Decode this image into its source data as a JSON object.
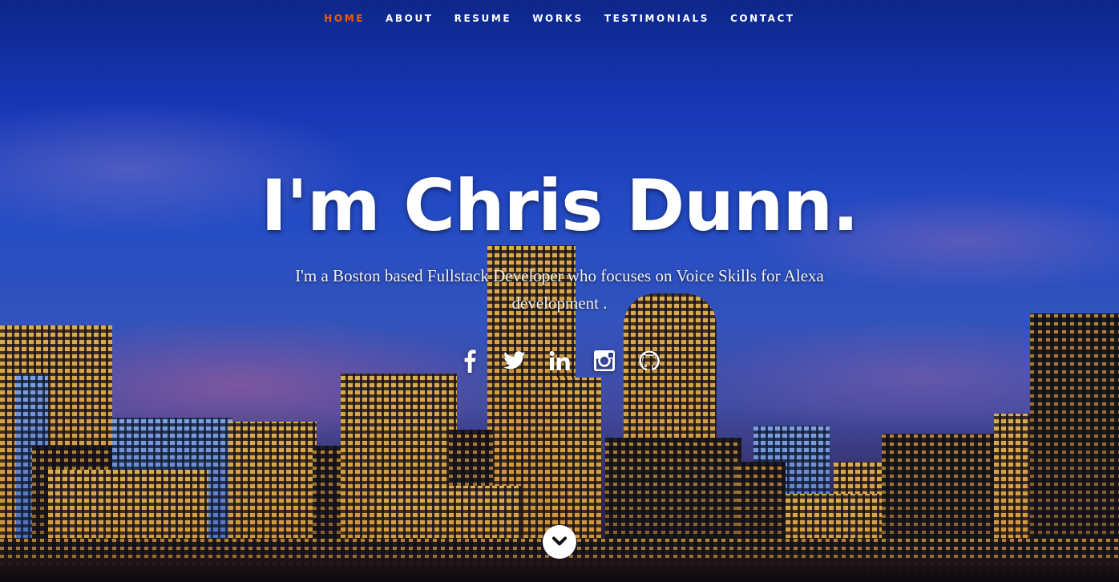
{
  "nav": {
    "items": [
      {
        "label": "HOME",
        "active": true
      },
      {
        "label": "ABOUT",
        "active": false
      },
      {
        "label": "RESUME",
        "active": false
      },
      {
        "label": "WORKS",
        "active": false
      },
      {
        "label": "TESTIMONIALS",
        "active": false
      },
      {
        "label": "CONTACT",
        "active": false
      }
    ],
    "active_color": "#f06000"
  },
  "banner": {
    "title": "I'm Chris Dunn.",
    "subtitle": "I'm a Boston based Fullstack Developer who focuses on Voice Skills for Alexa development ."
  },
  "social": {
    "icons": [
      "facebook-icon",
      "twitter-icon",
      "linkedin-icon",
      "instagram-icon",
      "github-icon"
    ]
  },
  "scroll": {
    "icon": "chevron-down-icon"
  }
}
